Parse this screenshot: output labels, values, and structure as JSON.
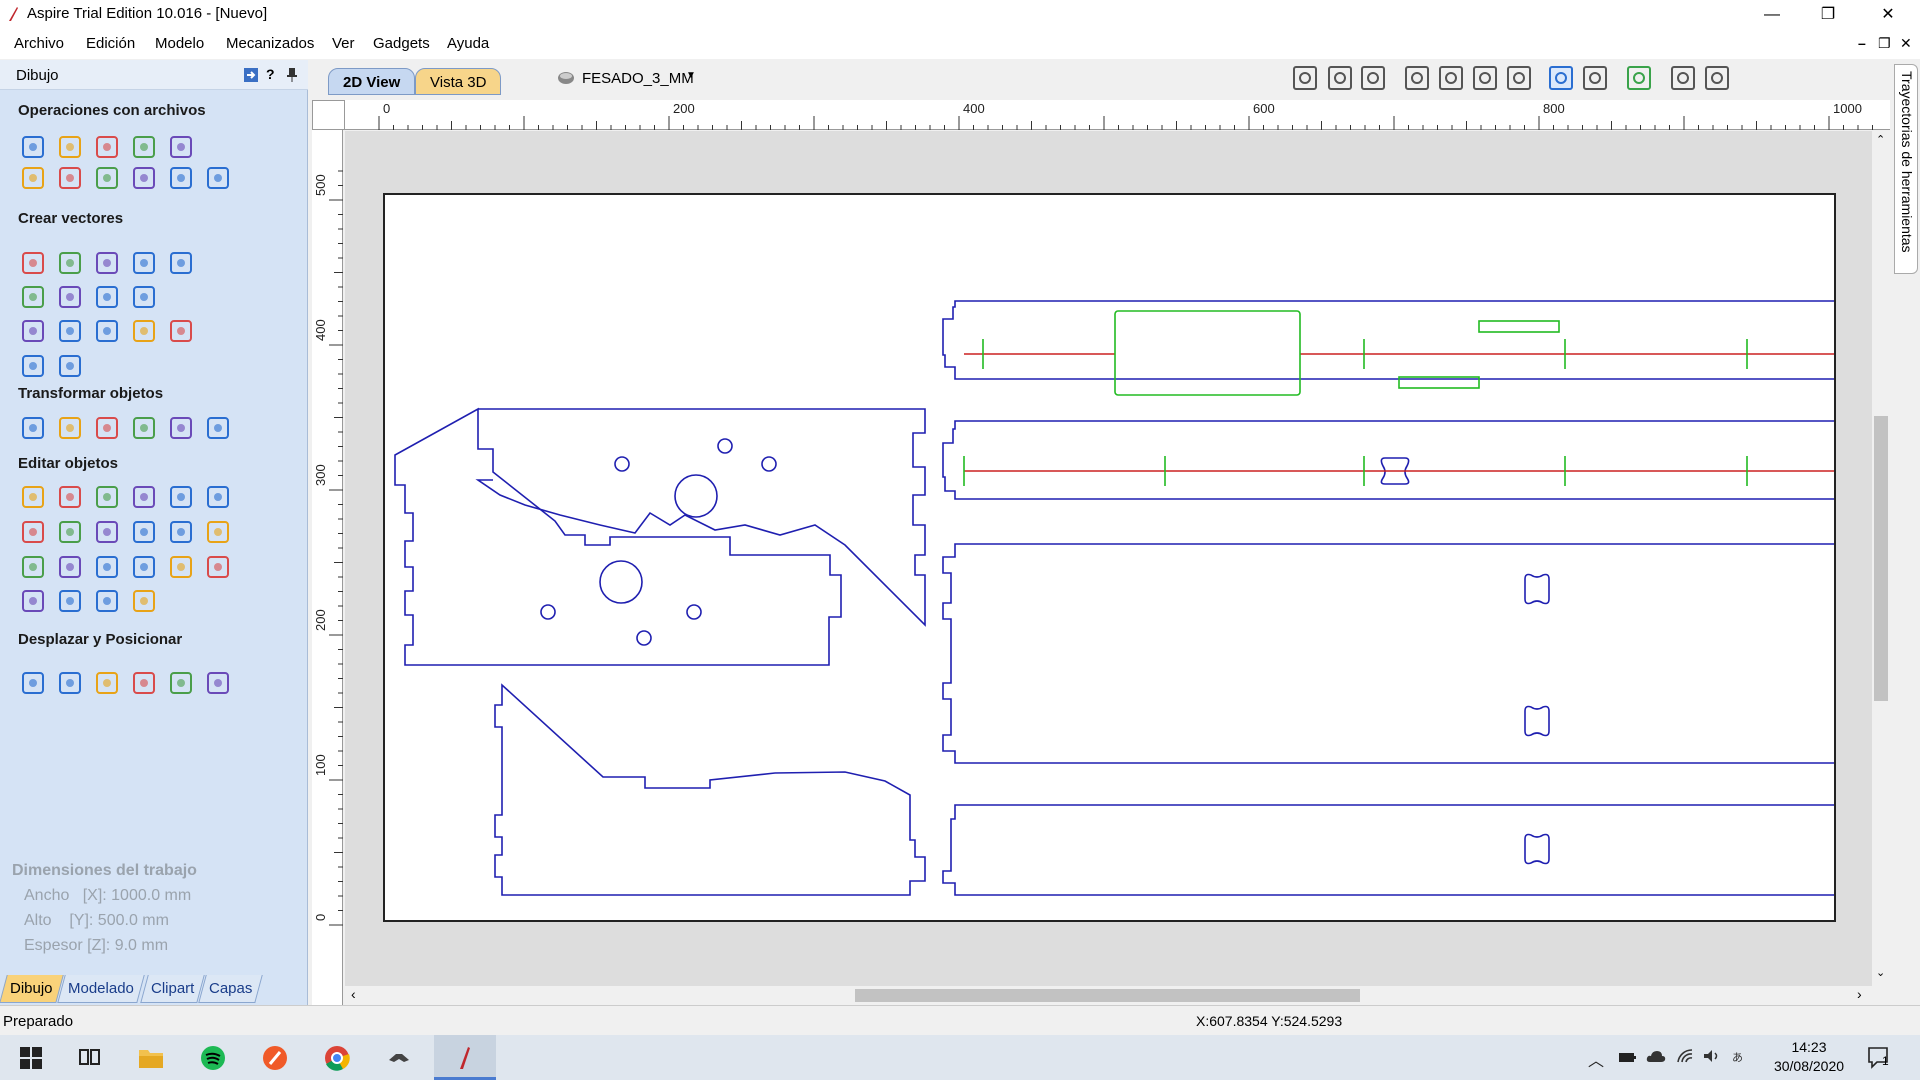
{
  "window": {
    "title": "Aspire Trial Edition 10.016 - [Nuevo]",
    "minimize": "—",
    "restore": "❐",
    "close": "✕"
  },
  "menu": {
    "items": [
      "Archivo",
      "Edición",
      "Modelo",
      "Mecanizados",
      "Ver",
      "Gadgets",
      "Ayuda"
    ],
    "mdi_controls": [
      "–",
      "❐",
      "✕"
    ]
  },
  "left_panel": {
    "title": "Dibujo",
    "help": "?",
    "sections": {
      "file_ops": "Operaciones con archivos",
      "create_vectors": "Crear vectores",
      "transform": "Transformar objetos",
      "edit": "Editar objetos",
      "move": "Desplazar y Posicionar"
    },
    "job_dims": {
      "heading": "Dimensiones del trabajo",
      "width": "Ancho   [X]: 1000.0 mm",
      "height": "Alto    [Y]: 500.0 mm",
      "thickness": "Espesor [Z]: 9.0 mm"
    },
    "tabs": [
      "Dibujo",
      "Modelado",
      "Clipart",
      "Capas"
    ]
  },
  "view": {
    "tab_2d": "2D View",
    "tab_3d": "Vista 3D",
    "toolpath_selector": "FESADO_3_MM"
  },
  "ruler": {
    "h_labels": [
      "0",
      "200",
      "400",
      "600",
      "800",
      "1000"
    ],
    "v_labels": [
      "500",
      "400",
      "300",
      "200",
      "100",
      "0"
    ]
  },
  "right_tab": "Trayectorias de herramientas",
  "status": {
    "text": "Preparado",
    "coords": "X:607.8354 Y:524.5293"
  },
  "taskbar": {
    "time": "14:23",
    "date": "30/08/2020",
    "notif_count": "1"
  },
  "colors": {
    "vector_blue": "#1f1fb0",
    "toolpath_red": "#cc2020",
    "toolpath_green": "#22bb22"
  }
}
